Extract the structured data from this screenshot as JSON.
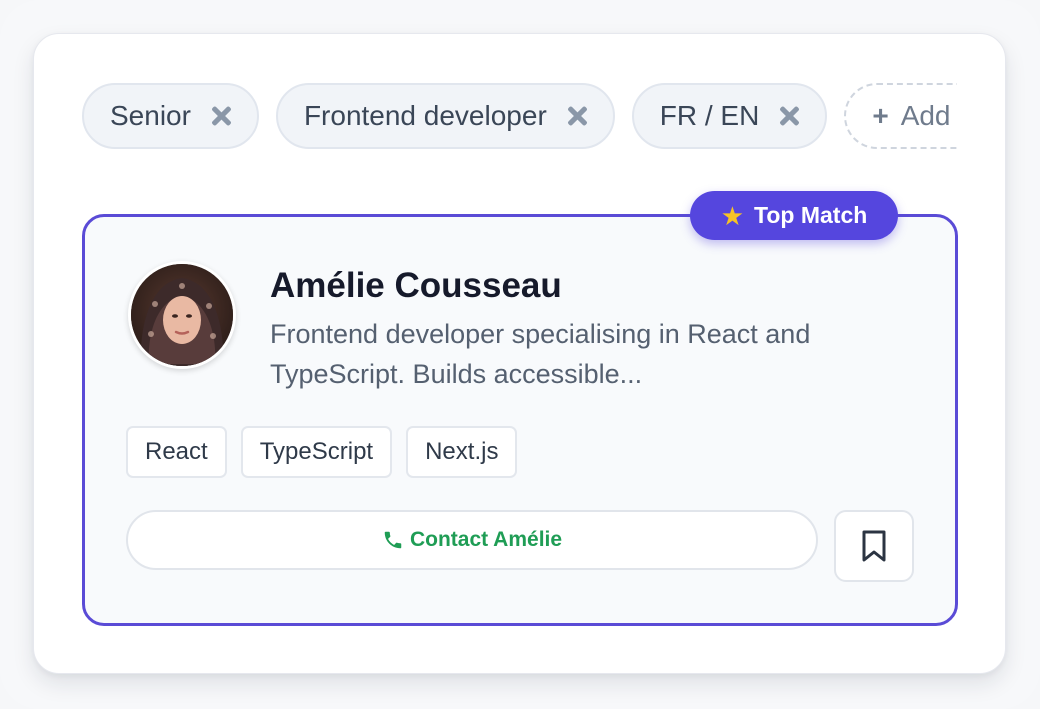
{
  "filters": [
    {
      "label": "Senior"
    },
    {
      "label": "Frontend developer"
    },
    {
      "label": "FR / EN"
    }
  ],
  "add_filter": {
    "icon": "plus-icon",
    "label": "Add f"
  },
  "badge": {
    "icon": "star-icon",
    "label": "Top Match"
  },
  "candidate": {
    "name": "Amélie Cousseau",
    "bio_line_1": "Frontend developer specialising in React and",
    "bio_line_2": "TypeScript. Builds accessible...",
    "skills": [
      "React",
      "TypeScript",
      "Next.js"
    ]
  },
  "actions": {
    "contact_label": "Contact Amélie",
    "contact_icon": "phone-icon",
    "bookmark_icon": "bookmark-icon"
  },
  "colors": {
    "accent": "#5546de",
    "contact_green": "#1f9d55",
    "star": "#f7c325"
  }
}
